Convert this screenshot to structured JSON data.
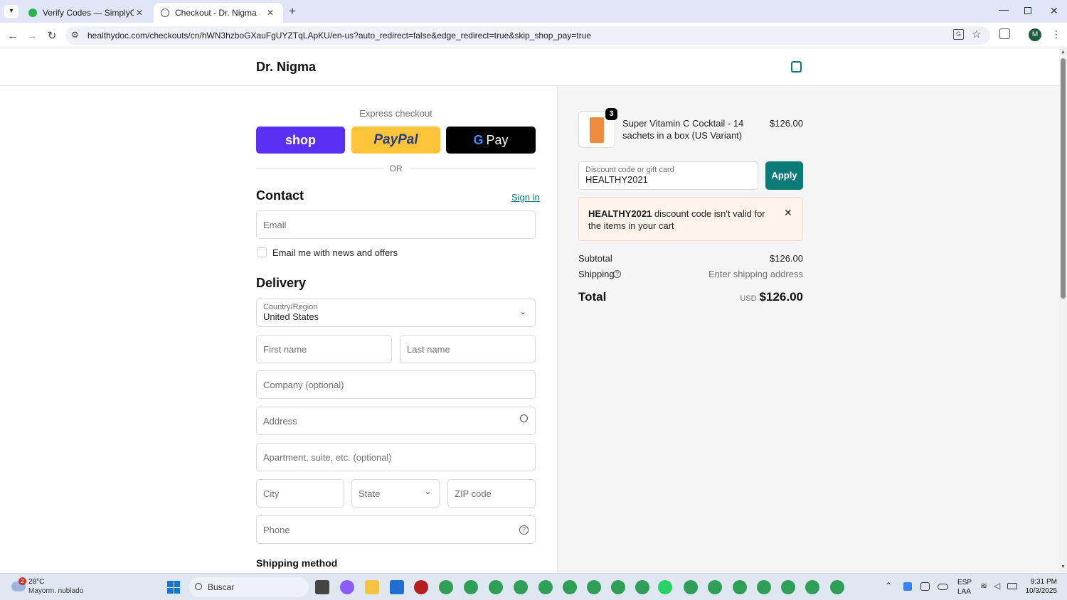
{
  "browser": {
    "tabs": [
      {
        "title": "Verify Codes — SimplyCodes"
      },
      {
        "title": "Checkout - Dr. Nigma"
      }
    ],
    "url": "healthydoc.com/checkouts/cn/hWN3hzboGXauFgUYZTqLApKU/en-us?auto_redirect=false&edge_redirect=true&skip_shop_pay=true",
    "profile_initial": "M"
  },
  "store": {
    "name": "Dr. Nigma"
  },
  "express": {
    "heading": "Express checkout",
    "shop_label": "shop",
    "paypal_label": "PayPal",
    "gpay_label": "Pay",
    "or_label": "OR"
  },
  "contact": {
    "heading": "Contact",
    "sign_in": "Sign in",
    "email_placeholder": "Email",
    "newsletter_label": "Email me with news and offers",
    "newsletter_checked": false
  },
  "delivery": {
    "heading": "Delivery",
    "country_label": "Country/Region",
    "country_value": "United States",
    "first_name": "First name",
    "last_name": "Last name",
    "company": "Company (optional)",
    "address": "Address",
    "apartment": "Apartment, suite, etc. (optional)",
    "city": "City",
    "state": "State",
    "zip": "ZIP code",
    "phone": "Phone"
  },
  "shipping_method": {
    "heading": "Shipping method"
  },
  "summary": {
    "item": {
      "quantity": "3",
      "name": "Super Vitamin C Cocktail - 14 sachets in a box (US Variant)",
      "price": "$126.00"
    },
    "discount": {
      "label": "Discount code or gift card",
      "value": "HEALTHY2021",
      "apply_label": "Apply"
    },
    "error": {
      "code": "HEALTHY2021",
      "message": " discount code isn't valid for the items in your cart"
    },
    "subtotal_label": "Subtotal",
    "subtotal_value": "$126.00",
    "shipping_label": "Shipping",
    "shipping_value": "Enter shipping address",
    "total_label": "Total",
    "currency": "USD",
    "total_value": "$126.00"
  },
  "taskbar": {
    "weather_temp": "28°C",
    "weather_desc": "Mayorm. nublado",
    "weather_badge": "2",
    "search_placeholder": "Buscar",
    "lang_top": "ESP",
    "lang_bottom": "LAA",
    "time": "9:31 PM",
    "date": "10/3/2025"
  },
  "colors": {
    "accent": "#0c7a77",
    "shop": "#5a31f4",
    "paypal": "#ffc439",
    "error_bg": "#fff4ec"
  }
}
